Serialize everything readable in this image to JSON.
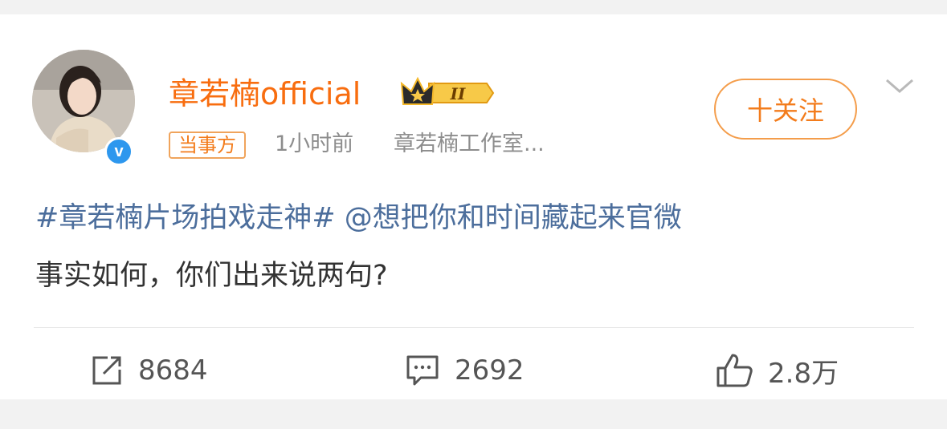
{
  "post": {
    "username": "章若楠official",
    "membership_level": "II",
    "tag": "当事方",
    "time": "1小时前",
    "source": "章若楠工作室...",
    "follow_label": "十关注",
    "content": {
      "topic": "#章若楠片场拍戏走神#",
      "mention": "@想把你和时间藏起来官微",
      "line2": "事实如何，你们出来说两句?"
    },
    "actions": {
      "repost_count": "8684",
      "comment_count": "2692",
      "like_count": "2.8万"
    },
    "colors": {
      "username": "#f86d0f",
      "link": "#4c6e9c",
      "verified": "#2d97ee",
      "follow": "#f37c1c"
    },
    "icons": [
      "verified-icon",
      "crown-badge-icon",
      "chevron-down-icon",
      "repost-icon",
      "comment-icon",
      "like-icon"
    ]
  }
}
